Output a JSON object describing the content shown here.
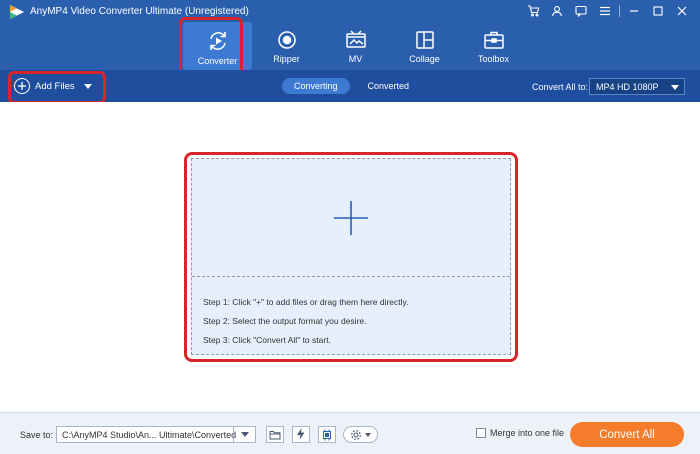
{
  "app": {
    "title": "AnyMP4 Video Converter Ultimate (Unregistered)",
    "logo_icon": "anymp4-play-logo"
  },
  "window_controls": {
    "icons": [
      "cart-icon",
      "user-icon",
      "chat-icon",
      "menu-icon",
      "minimize-icon",
      "maximize-icon",
      "close-icon"
    ]
  },
  "nav": {
    "items": [
      {
        "label": "Converter",
        "icon": "converter-icon",
        "active": true
      },
      {
        "label": "Ripper",
        "icon": "ripper-icon",
        "active": false
      },
      {
        "label": "MV",
        "icon": "mv-icon",
        "active": false
      },
      {
        "label": "Collage",
        "icon": "collage-icon",
        "active": false
      },
      {
        "label": "Toolbox",
        "icon": "toolbox-icon",
        "active": false
      }
    ]
  },
  "toolbar": {
    "add_files_label": "Add Files",
    "tabs": [
      {
        "label": "Converting",
        "active": true
      },
      {
        "label": "Converted",
        "active": false
      }
    ],
    "convert_all_to_label": "Convert All to:",
    "format_value": "MP4 HD 1080P"
  },
  "dropzone": {
    "plus_icon": "plus-icon",
    "steps": [
      "Step 1: Click \"+\" to add files or drag them here directly.",
      "Step 2: Select the output format you desire.",
      "Step 3: Click \"Convert All\" to start."
    ]
  },
  "bottom": {
    "save_to_label": "Save to:",
    "path_value": "C:\\AnyMP4 Studio\\An... Ultimate\\Converted",
    "merge_label": "Merge into one file",
    "merge_checked": false,
    "convert_all_label": "Convert All"
  },
  "colors": {
    "header_blue": "#2a5fae",
    "subbar_blue": "#1f4e9e",
    "active_tab": "#3d7ad1",
    "highlight_red": "#d6252b",
    "dropzone_bg": "#e6f0fc",
    "convert_orange": "#f47c2b"
  }
}
